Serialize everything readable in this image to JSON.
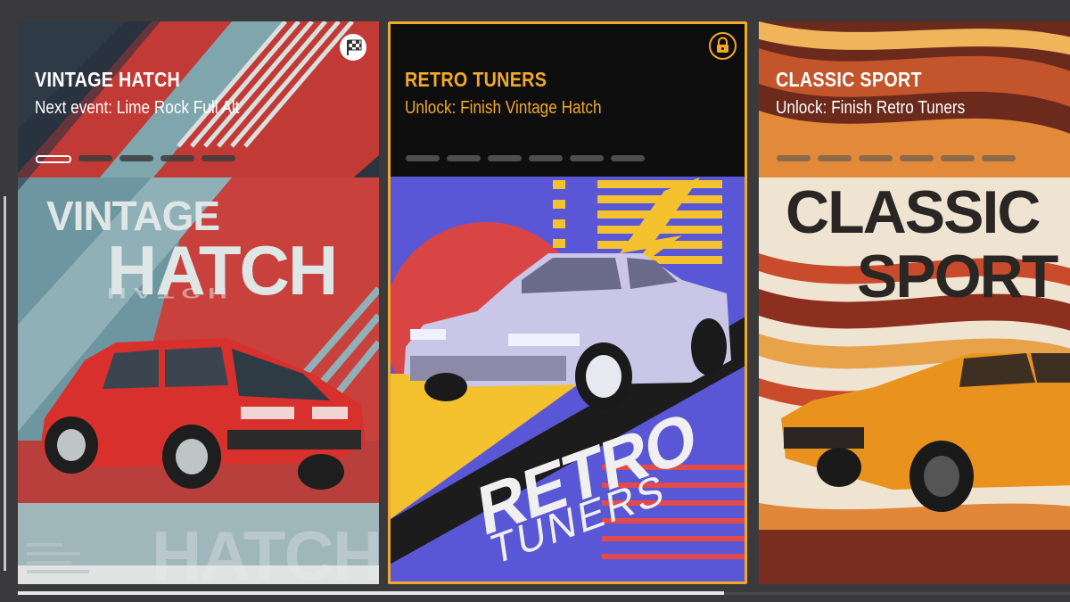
{
  "cards": [
    {
      "title": "VINTAGE HATCH",
      "subtitle": "Next event: Lime Rock Full Alt",
      "poster_line1": "VINTAGE",
      "poster_line2": "HATCH",
      "poster_footer": "HATCH",
      "badge_icon": "checkered-flag-icon",
      "progress_total": 5,
      "progress_active": 1,
      "state": "available"
    },
    {
      "title": "RETRO TUNERS",
      "subtitle": "Unlock: Finish Vintage Hatch",
      "poster_line1": "RETRO",
      "poster_line2": "TUNERS",
      "badge_icon": "padlock-icon",
      "progress_total": 6,
      "progress_active": 0,
      "state": "locked",
      "selected": true
    },
    {
      "title": "CLASSIC SPORT",
      "subtitle": "Unlock: Finish Retro Tuners",
      "poster_line1": "CLASSIC",
      "poster_line2": "SPORT",
      "progress_total": 6,
      "progress_active": 0,
      "state": "locked"
    }
  ],
  "colors": {
    "accent": "#f2a92a",
    "text_primary": "#ffffff",
    "background": "#3a3a3c"
  },
  "scrollbar": {
    "position_fraction": 0.67
  }
}
